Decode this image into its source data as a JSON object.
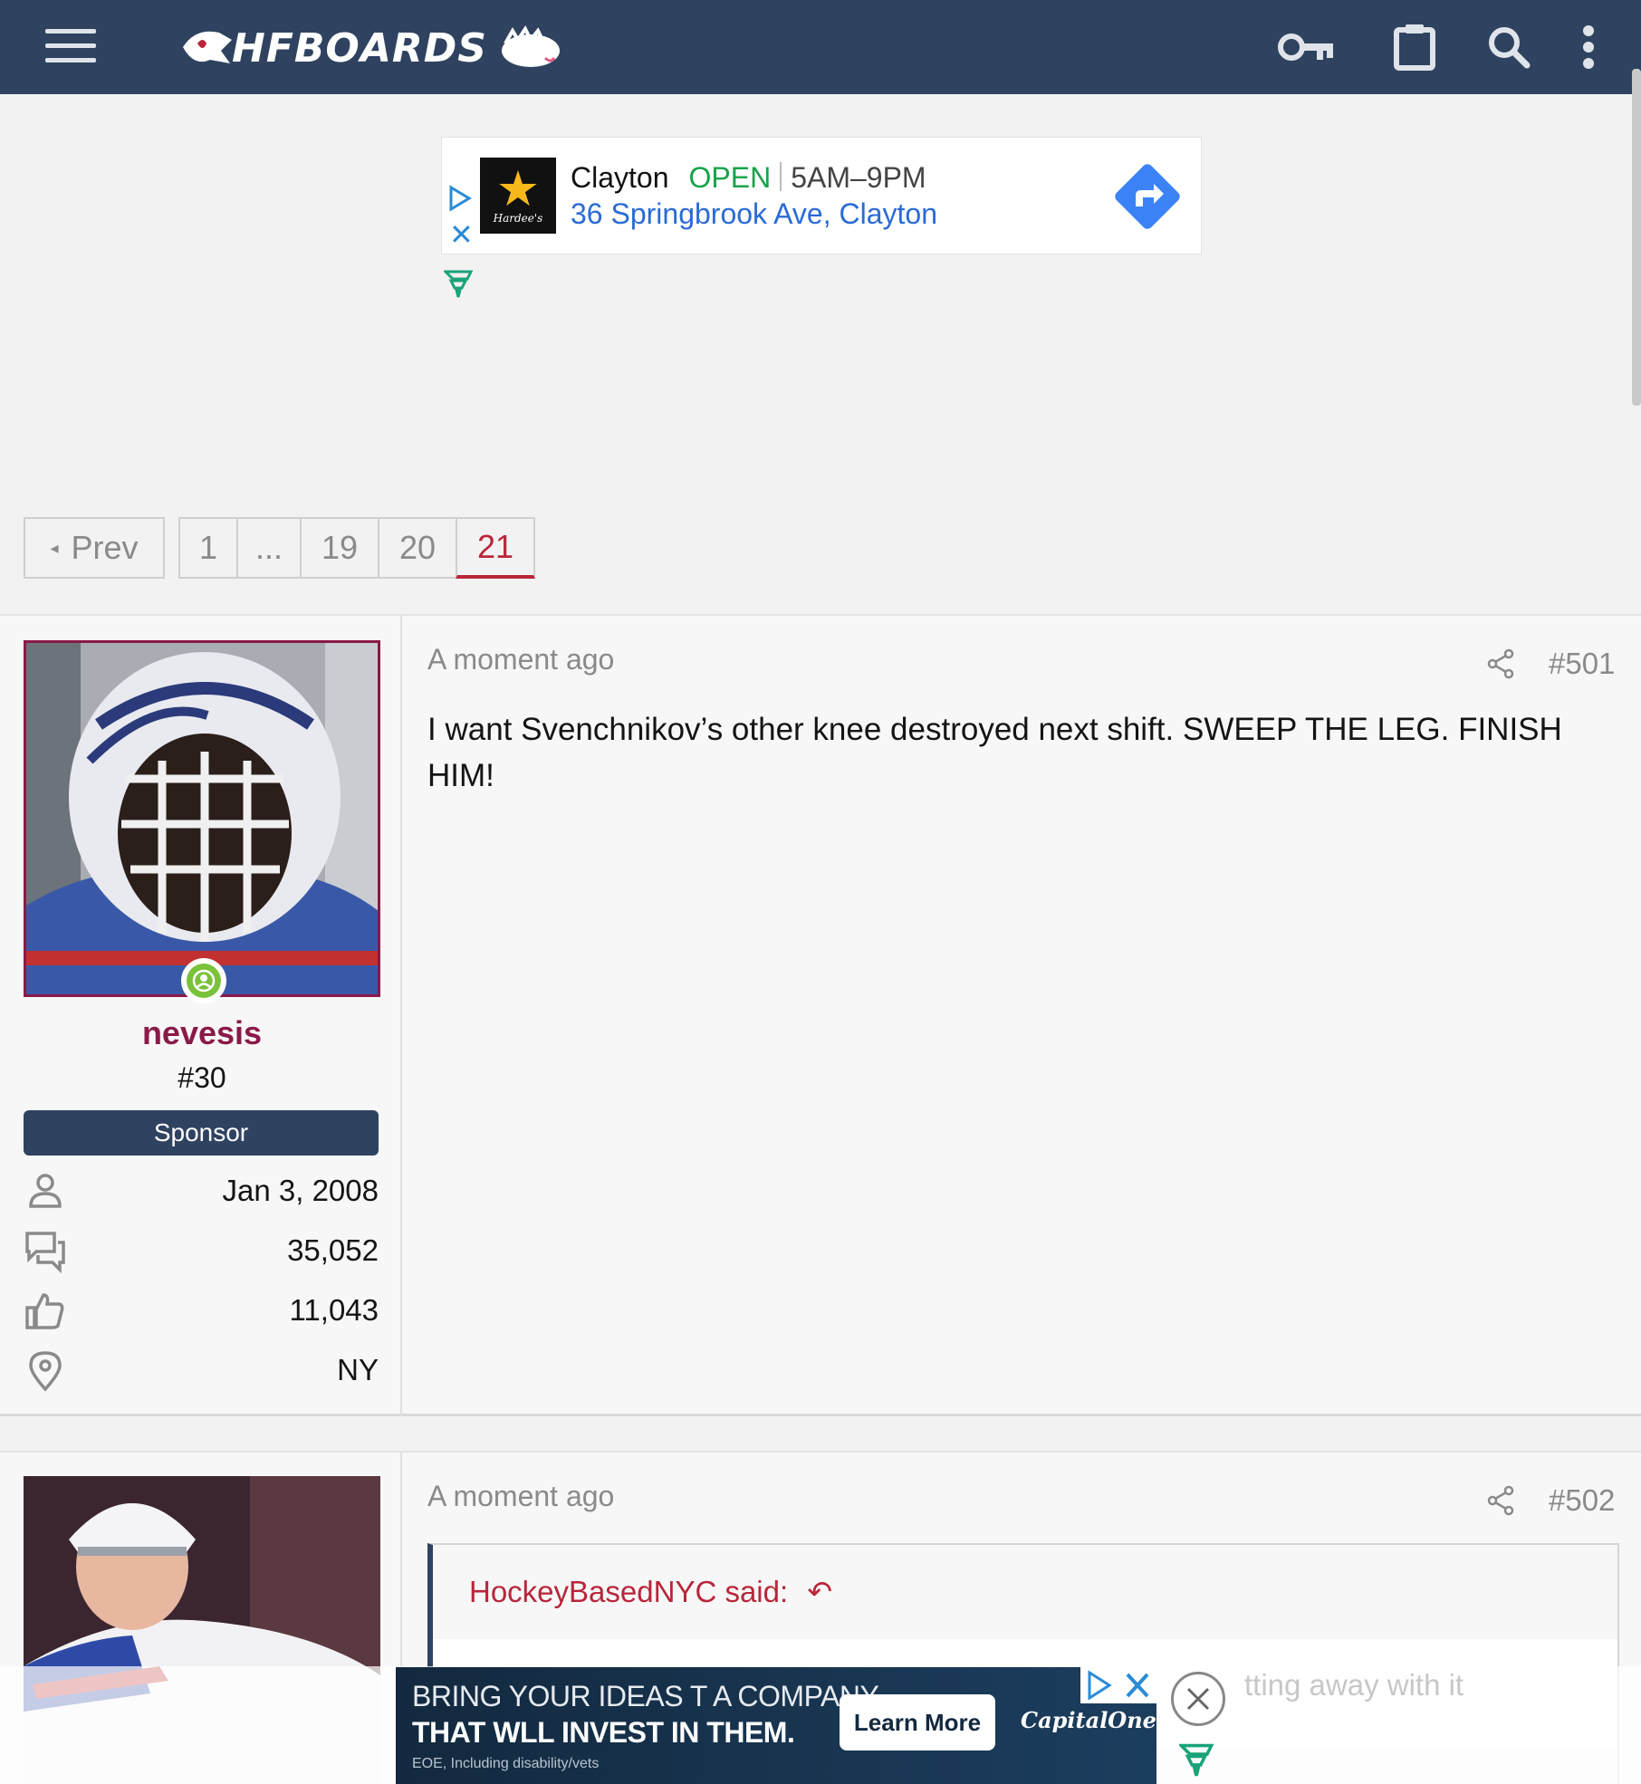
{
  "header": {
    "logo_text": "HFBOARDS",
    "icons": [
      "menu-icon",
      "key-icon",
      "clipboard-icon",
      "search-icon",
      "more-vertical-icon"
    ],
    "bg_color": "#2f4360"
  },
  "ad_top": {
    "logo_brand": "Hardee's",
    "location": "Clayton",
    "status": "OPEN",
    "hours": "5AM–9PM",
    "address": "36 Springbrook Ave, Clayton"
  },
  "pagination": {
    "prev_label": "Prev",
    "pages": [
      "1",
      "...",
      "19",
      "20",
      "21"
    ],
    "current": "21"
  },
  "posts": [
    {
      "time": "A moment ago",
      "number": "#501",
      "body": "I want Svenchnikov’s other knee destroyed next shift. SWEEP THE LEG. FINISH HIM!",
      "user": {
        "name": "nevesis",
        "title": "#30",
        "banner": "Sponsor",
        "joined": "Jan 3, 2008",
        "messages": "35,052",
        "reactions": "11,043",
        "location": "NY",
        "online": true
      }
    },
    {
      "time": "A moment ago",
      "number": "#502",
      "quote": {
        "author_line": "HockeyBasedNYC said:",
        "visible_fragment": "tting away with it"
      }
    }
  ],
  "ad_bottom": {
    "line1": "BRING YOUR IDEAS T A COMPANY",
    "line2": "THAT WLL INVEST IN THEM.",
    "line3": "EOE, Including disability/vets",
    "cta": "Learn More",
    "brand": "CapitalOne"
  },
  "colors": {
    "accent": "#b8263a",
    "username": "#8a1a48",
    "online": "#7ac23a",
    "link": "#2a6bd6",
    "open": "#16a34a"
  }
}
